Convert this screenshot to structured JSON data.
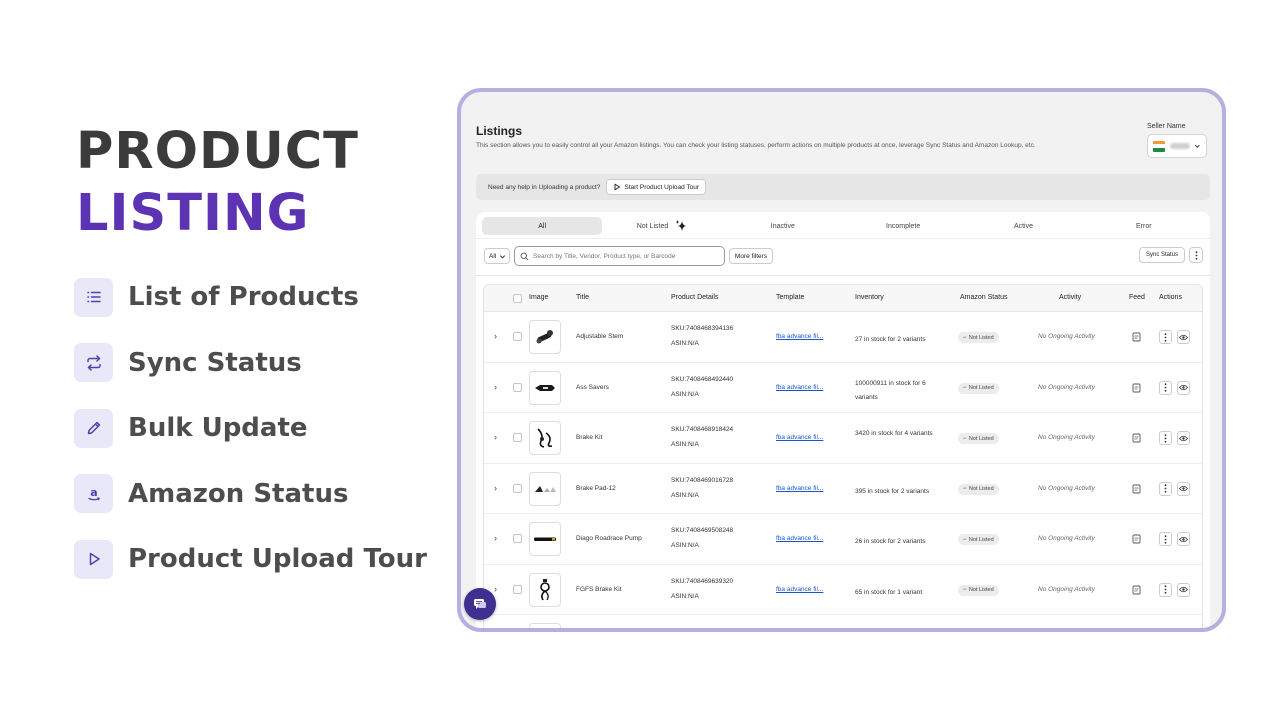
{
  "hero": {
    "line1": "PRODUCT",
    "line2": "LISTING",
    "accent_color": "#5b33b3",
    "features": [
      {
        "label": "List of Products",
        "icon": "list-icon"
      },
      {
        "label": "Sync Status",
        "icon": "sync-icon"
      },
      {
        "label": "Bulk Update",
        "icon": "pencil-icon"
      },
      {
        "label": "Amazon Status",
        "icon": "amazon-icon"
      },
      {
        "label": "Product Upload Tour",
        "icon": "play-icon"
      }
    ]
  },
  "app": {
    "title": "Listings",
    "description": "This section allows you to easily control all your Amazon listings. You can check your listing statuses, perform actions on multiple products at once, leverage Sync Status and Amazon Lookup, etc.",
    "seller_label": "Seller Name",
    "help_text": "Need any help in Uploading a product?",
    "tour_button": "Start Product Upload Tour",
    "tabs": [
      "All",
      "Not Listed",
      "Inactive",
      "Incomplete",
      "Active",
      "Error"
    ],
    "filter_all": "All",
    "search_placeholder": "Search by Title, Vendor, Product type, or Barcode",
    "more_filters": "More filters",
    "sync_status": "Sync Status",
    "columns": {
      "image": "Image",
      "title": "Title",
      "details": "Product Details",
      "template": "Template",
      "inventory": "Inventory",
      "status": "Amazon Status",
      "activity": "Activity",
      "feed": "Feed",
      "actions": "Actions"
    },
    "rows": [
      {
        "title": "Adjustable Stem",
        "sku": "SKU:7408468394136",
        "asin": "ASIN:N/A",
        "template": "fba advance fil...",
        "inventory": "27 in stock for 2 variants",
        "status": "Not Listed",
        "activity": "No Ongoing Activity"
      },
      {
        "title": "Ass Savers",
        "sku": "SKU:7408468492440",
        "asin": "ASIN:N/A",
        "template": "fba advance fil...",
        "inventory": "100000911 in stock for 6 variants",
        "status": "Not Listed",
        "activity": "No Ongoing Activity"
      },
      {
        "title": "Brake Kit",
        "sku": "SKU:7408468918424",
        "asin": "ASIN:N/A",
        "template": "fba advance fil...",
        "inventory": "3420 in stock for 4 variants",
        "status": "Not Listed",
        "activity": "No Ongoing Activity"
      },
      {
        "title": "Brake Pad-12",
        "sku": "SKU:7408469016728",
        "asin": "ASIN:N/A",
        "template": "fba advance fil...",
        "inventory": "395 in stock for 2 variants",
        "status": "Not Listed",
        "activity": "No Ongoing Activity"
      },
      {
        "title": "Diago Roadrace Pump",
        "sku": "SKU:7408469508248",
        "asin": "ASIN:N/A",
        "template": "fba advance fil...",
        "inventory": "26 in stock for 2 variants",
        "status": "Not Listed",
        "activity": "No Ongoing Activity"
      },
      {
        "title": "FGFS Brake Kit",
        "sku": "SKU:7408469639320",
        "asin": "ASIN:N/A",
        "template": "fba advance fil...",
        "inventory": "65 in stock for 1 variant",
        "status": "Not Listed",
        "activity": "No Ongoing Activity"
      }
    ]
  }
}
